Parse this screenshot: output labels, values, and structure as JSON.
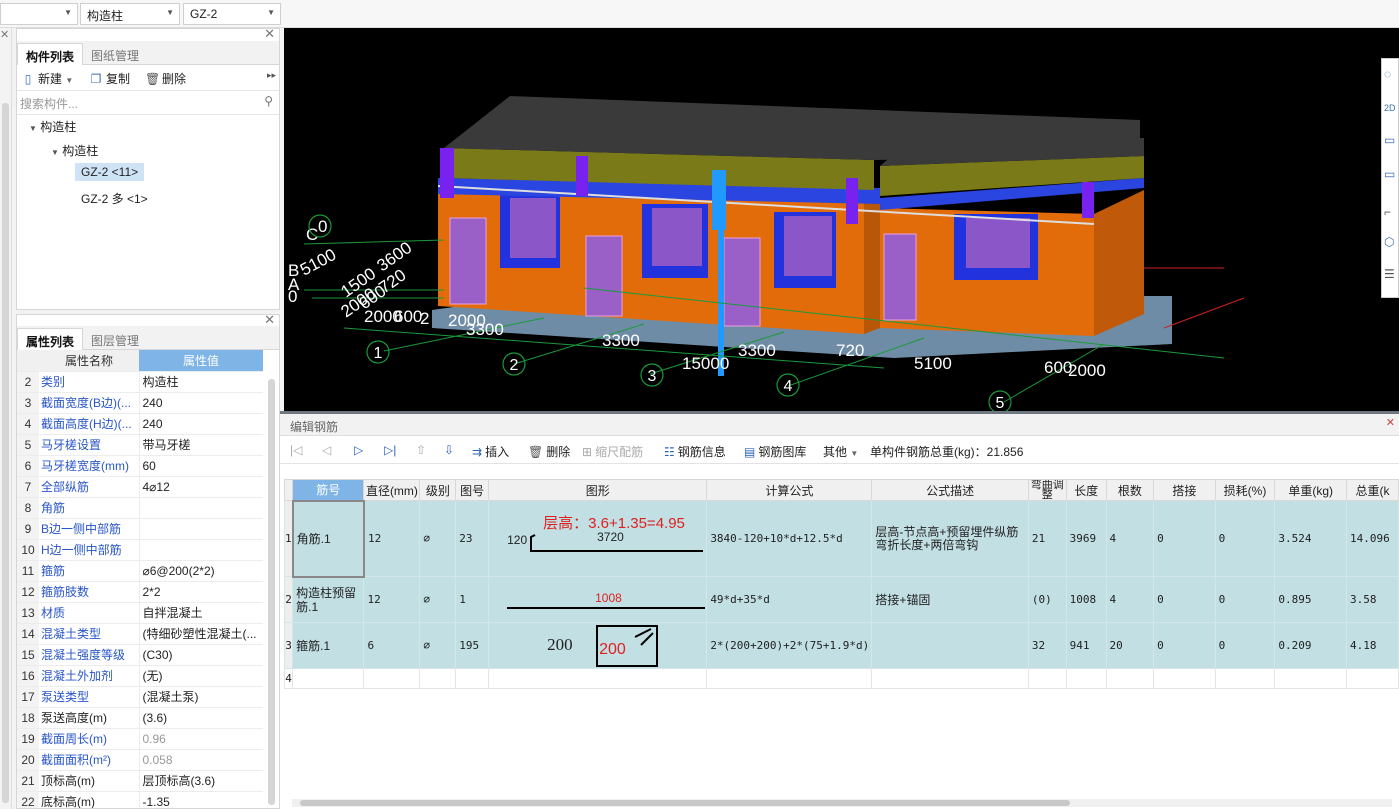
{
  "topbar": {
    "combo1": "",
    "combo2": "构造柱",
    "combo3": "GZ-2"
  },
  "component_panel": {
    "tabs": [
      "构件列表",
      "图纸管理"
    ],
    "toolbar": {
      "new": "新建",
      "copy": "复制",
      "delete": "删除"
    },
    "search_placeholder": "搜索构件...",
    "tree": {
      "root": "构造柱",
      "child": "构造柱",
      "items": [
        "GZ-2 <11>",
        "GZ-2 多 <1>"
      ]
    }
  },
  "property_panel": {
    "tabs": [
      "属性列表",
      "图层管理"
    ],
    "headers": {
      "name": "属性名称",
      "value": "属性值"
    },
    "rows": [
      {
        "no": "2",
        "name": "类别",
        "value": "构造柱",
        "blue": true,
        "gray": false
      },
      {
        "no": "3",
        "name": "截面宽度(B边)(...",
        "value": "240",
        "blue": true,
        "gray": false
      },
      {
        "no": "4",
        "name": "截面高度(H边)(...",
        "value": "240",
        "blue": true,
        "gray": false
      },
      {
        "no": "5",
        "name": "马牙槎设置",
        "value": "带马牙槎",
        "blue": true,
        "gray": false
      },
      {
        "no": "6",
        "name": "马牙槎宽度(mm)",
        "value": "60",
        "blue": true,
        "gray": false
      },
      {
        "no": "7",
        "name": "全部纵筋",
        "value": "4⌀12",
        "blue": true,
        "gray": false
      },
      {
        "no": "8",
        "name": "角筋",
        "value": "",
        "blue": true,
        "gray": false
      },
      {
        "no": "9",
        "name": "B边一侧中部筋",
        "value": "",
        "blue": true,
        "gray": false
      },
      {
        "no": "10",
        "name": "H边一侧中部筋",
        "value": "",
        "blue": true,
        "gray": false
      },
      {
        "no": "11",
        "name": "箍筋",
        "value": "⌀6@200(2*2)",
        "blue": true,
        "gray": false
      },
      {
        "no": "12",
        "name": "箍筋肢数",
        "value": "2*2",
        "blue": true,
        "gray": false
      },
      {
        "no": "13",
        "name": "材质",
        "value": "自拌混凝土",
        "blue": true,
        "gray": false
      },
      {
        "no": "14",
        "name": "混凝土类型",
        "value": "(特细砂塑性混凝土(...",
        "blue": true,
        "gray": false
      },
      {
        "no": "15",
        "name": "混凝土强度等级",
        "value": "(C30)",
        "blue": true,
        "gray": false
      },
      {
        "no": "16",
        "name": "混凝土外加剂",
        "value": "(无)",
        "blue": true,
        "gray": false
      },
      {
        "no": "17",
        "name": "泵送类型",
        "value": "(混凝土泵)",
        "blue": true,
        "gray": false
      },
      {
        "no": "18",
        "name": "泵送高度(m)",
        "value": "(3.6)",
        "blue": false,
        "gray": false
      },
      {
        "no": "19",
        "name": "截面周长(m)",
        "value": "0.96",
        "blue": true,
        "gray": true
      },
      {
        "no": "20",
        "name": "截面面积(m²)",
        "value": "0.058",
        "blue": true,
        "gray": true
      },
      {
        "no": "21",
        "name": "顶标高(m)",
        "value": "层顶标高(3.6)",
        "blue": false,
        "gray": false
      },
      {
        "no": "22",
        "name": "底标高(m)",
        "value": "-1.35",
        "blue": false,
        "gray": false
      }
    ]
  },
  "viewport": {
    "labels": {
      "axes_left": [
        "C",
        "0",
        "B",
        "A",
        "0"
      ],
      "dims_left": [
        "5100",
        "1500",
        "3600",
        "600",
        "720",
        "2000",
        "2000",
        "600",
        "2"
      ],
      "bottom_dims": [
        "2000",
        "3300",
        "3300",
        "3300",
        "15000",
        "720",
        "5100",
        "600",
        "2000"
      ],
      "grid_nums": [
        "1",
        "2",
        "3",
        "4",
        "5"
      ]
    }
  },
  "editor": {
    "title": "编辑钢筋",
    "toolbar": {
      "insert": "插入",
      "delete": "删除",
      "scale": "缩尺配筋",
      "info": "钢筋信息",
      "library": "钢筋图库",
      "other": "其他",
      "total_label": "单构件钢筋总重(kg)：",
      "total_value": "21.856"
    },
    "columns": [
      "筋号",
      "直径(mm)",
      "级别",
      "图号",
      "图形",
      "计算公式",
      "公式描述",
      "弯曲调整",
      "长度",
      "根数",
      "搭接",
      "损耗(%)",
      "单重(kg)",
      "总重(k"
    ],
    "rows": [
      {
        "rn": "1",
        "name": "角筋.1",
        "dia": "12",
        "grade": "⌀",
        "fig": "23",
        "shape": {
          "left": "120",
          "mid": "3720",
          "note": "层高：3.6+1.35=4.95"
        },
        "formula": "3840-120+10*d+12.5*d",
        "desc": "层高-节点高+预留埋件纵筋弯折长度+两倍弯钩",
        "bend": "21",
        "len": "3969",
        "count": "4",
        "lap": "0",
        "loss": "0",
        "unit": "3.524",
        "total": "14.096"
      },
      {
        "rn": "2",
        "name": "构造柱预留筋.1",
        "dia": "12",
        "grade": "⌀",
        "fig": "1",
        "shape": {
          "mid": "1008"
        },
        "formula": "49*d+35*d",
        "desc": "搭接+锚固",
        "bend": "(0)",
        "len": "1008",
        "count": "4",
        "lap": "0",
        "loss": "0",
        "unit": "0.895",
        "total": "3.58"
      },
      {
        "rn": "3",
        "name": "箍筋.1",
        "dia": "6",
        "grade": "⌀",
        "fig": "195",
        "shape": {
          "left": "200",
          "box": "200"
        },
        "formula": "2*(200+200)+2*(75+1.9*d)",
        "desc": "",
        "bend": "32",
        "len": "941",
        "count": "20",
        "lap": "0",
        "loss": "0",
        "unit": "0.209",
        "total": "4.18"
      },
      {
        "rn": "4",
        "name": "",
        "dia": "",
        "grade": "",
        "fig": "",
        "shape": {},
        "formula": "",
        "desc": "",
        "bend": "",
        "len": "",
        "count": "",
        "lap": "",
        "loss": "",
        "unit": "",
        "total": ""
      }
    ]
  },
  "colors": {
    "accent": "#7eb4e6",
    "row_bg": "#c2dfe3",
    "viewport_bg": "#000000",
    "shape_red": "#e02020"
  }
}
